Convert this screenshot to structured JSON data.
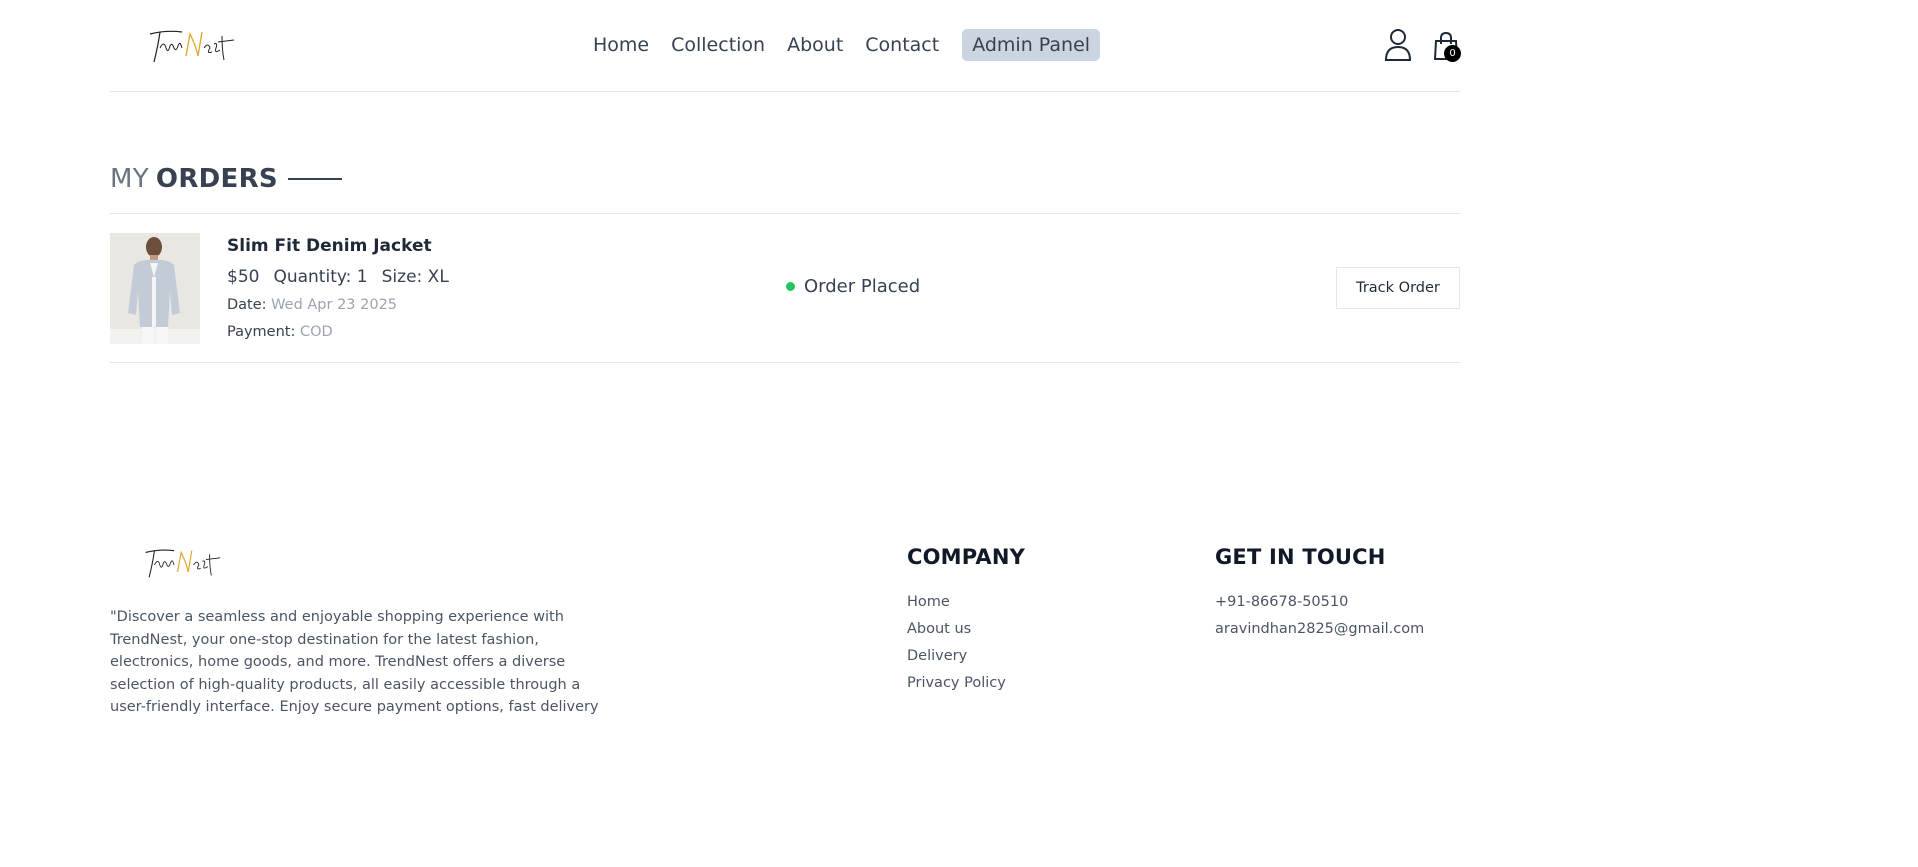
{
  "header": {
    "logo_alt": "TrendNest",
    "nav": [
      {
        "label": "Home"
      },
      {
        "label": "Collection"
      },
      {
        "label": "About"
      },
      {
        "label": "Contact"
      }
    ],
    "admin_label": "Admin Panel",
    "cart_count": "0"
  },
  "main": {
    "title_light": "MY",
    "title_dark": "ORDERS",
    "orders": [
      {
        "name": "Slim Fit Denim Jacket",
        "price": "$50",
        "quantity": "Quantity: 1",
        "size": "Size: XL",
        "date_label": "Date:",
        "date_value": "Wed Apr 23 2025",
        "payment_label": "Payment:",
        "payment_value": "COD",
        "status": "Order Placed",
        "status_color": "#22c55e",
        "track_label": "Track Order"
      }
    ]
  },
  "footer": {
    "description": "\"Discover a seamless and enjoyable shopping experience with TrendNest, your one-stop destination for the latest fashion, electronics, home goods, and more. TrendNest offers a diverse selection of high-quality products, all easily accessible through a user-friendly interface. Enjoy secure payment options, fast delivery",
    "company_title": "COMPANY",
    "company_links": [
      {
        "label": "Home"
      },
      {
        "label": "About us"
      },
      {
        "label": "Delivery"
      },
      {
        "label": "Privacy Policy"
      }
    ],
    "touch_title": "GET IN TOUCH",
    "phone": "+91-86678-50510",
    "email": "aravindhan2825@gmail.com"
  },
  "colors": {
    "admin_bg": "#cbd5e1",
    "logo_gold": "#e0a62b"
  }
}
